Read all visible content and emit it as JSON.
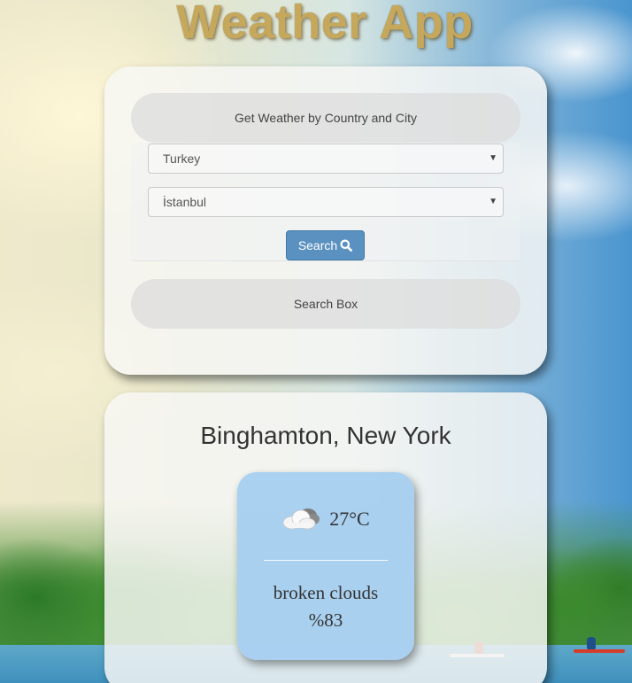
{
  "app": {
    "title": "Weather App"
  },
  "search": {
    "header": "Get Weather by Country and City",
    "country_select": {
      "selected": "Turkey"
    },
    "city_select": {
      "selected": "İstanbul"
    },
    "search_button_label": "Search",
    "search_button_icon": "search-icon",
    "search_box_label": "Search Box"
  },
  "result": {
    "location": "Binghamton, New York",
    "weather_icon": "cloud-icon",
    "temperature": "27°C",
    "description": "broken clouds",
    "humidity": "%83"
  },
  "colors": {
    "title": "#c6a85c",
    "button": "#5a91c0",
    "tile": "#a5cdf0"
  }
}
